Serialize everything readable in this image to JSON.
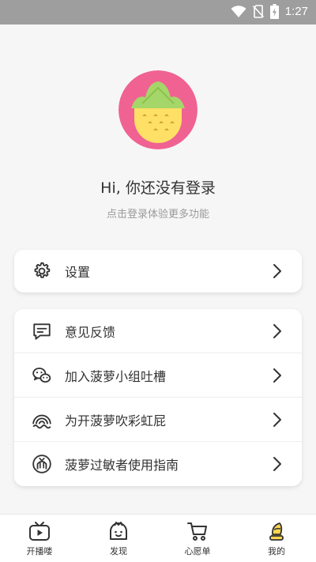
{
  "status_bar": {
    "time": "1:27",
    "icons": [
      "wifi-icon",
      "no-sim-icon",
      "battery-charging-icon"
    ]
  },
  "profile": {
    "greeting": "Hi, 你还没有登录",
    "subtitle": "点击登录体验更多功能",
    "avatar_icon": "pineapple-avatar-icon",
    "avatar_bg": "#f06292",
    "avatar_fruit": "#ffe066",
    "avatar_leaves": "#a5d66a"
  },
  "settings": {
    "label": "设置",
    "icon": "gear-icon"
  },
  "menu": [
    {
      "label": "意见反馈",
      "icon": "feedback-icon"
    },
    {
      "label": "加入菠萝小组吐槽",
      "icon": "wechat-icon"
    },
    {
      "label": "为开菠萝吹彩虹屁",
      "icon": "rainbow-icon"
    },
    {
      "label": "菠萝过敏者使用指南",
      "icon": "guide-icon"
    }
  ],
  "tabbar": [
    {
      "label": "开播喽",
      "icon": "tv-icon",
      "active": false
    },
    {
      "label": "发现",
      "icon": "discover-icon",
      "active": false
    },
    {
      "label": "心愿单",
      "icon": "cart-icon",
      "active": false
    },
    {
      "label": "我的",
      "icon": "profile-icon",
      "active": true
    }
  ],
  "colors": {
    "accent": "#ffd54f",
    "text": "#333333",
    "muted": "#9a9a9a",
    "status_bar": "#9e9e9e"
  }
}
